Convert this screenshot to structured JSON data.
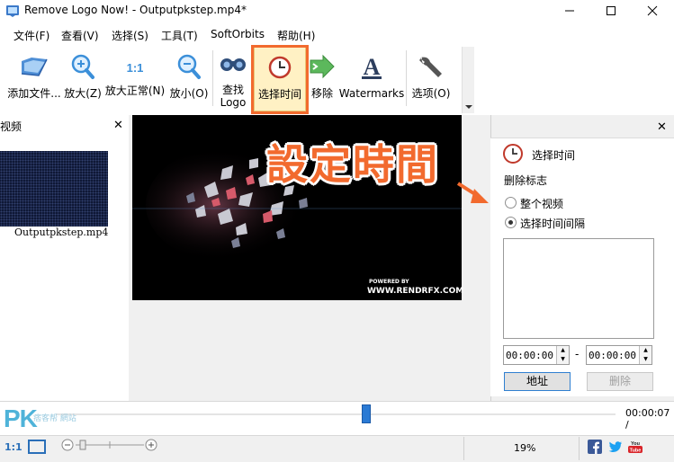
{
  "window": {
    "title": "Remove Logo Now! - Outputpkstep.mp4*"
  },
  "menu": [
    "文件(F)",
    "查看(V)",
    "选择(S)",
    "工具(T)",
    "SoftOrbits",
    "帮助(H)"
  ],
  "toolbar": {
    "add_file": "添加文件...",
    "zoom_in": "放大(Z)",
    "zoom_normal": "放大正常(N)",
    "zoom_out": "放小(O)",
    "find_logo": "查找\nLogo",
    "select_time": "选择时间",
    "remove": "移除",
    "watermarks": "Watermarks",
    "options": "选项(O)"
  },
  "left_panel": {
    "header": "视频",
    "thumbnail_caption": "Outputpkstep.mp4"
  },
  "video": {
    "powered_by": "POWERED BY",
    "site": "WWW.RENDRFX.COM"
  },
  "annotation": {
    "text": "設定時間",
    "color": "#f26a2e"
  },
  "right_panel": {
    "title": "选择时间",
    "subtitle": "删除标志",
    "option_whole": "整个视频",
    "option_interval": "选择时间间隔",
    "selected_option": "option_interval",
    "start_time": "00:00:00",
    "end_time": "00:00:00",
    "dash": "-",
    "address_button": "地址",
    "delete_button": "删除"
  },
  "timeline": {
    "readout": "00:00:07 /",
    "position_fraction": 0.55
  },
  "status": {
    "ratio": "1:1",
    "zoom_percent": "19%"
  },
  "watermark_logo": {
    "text": "PK",
    "sub": "痞客帮 網站"
  },
  "colors": {
    "accent": "#f26a2e",
    "handle": "#2a7ad4",
    "logo": "#4fb3d9"
  },
  "icons": [
    "app-icon",
    "minimize-icon",
    "maximize-icon",
    "close-icon",
    "add-file-icon",
    "zoom-in-icon",
    "zoom-normal-icon",
    "zoom-out-icon",
    "binoculars-icon",
    "clock-icon",
    "arrow-icon",
    "watermark-icon",
    "wrench-icon",
    "facebook-icon",
    "twitter-icon",
    "youtube-icon"
  ]
}
